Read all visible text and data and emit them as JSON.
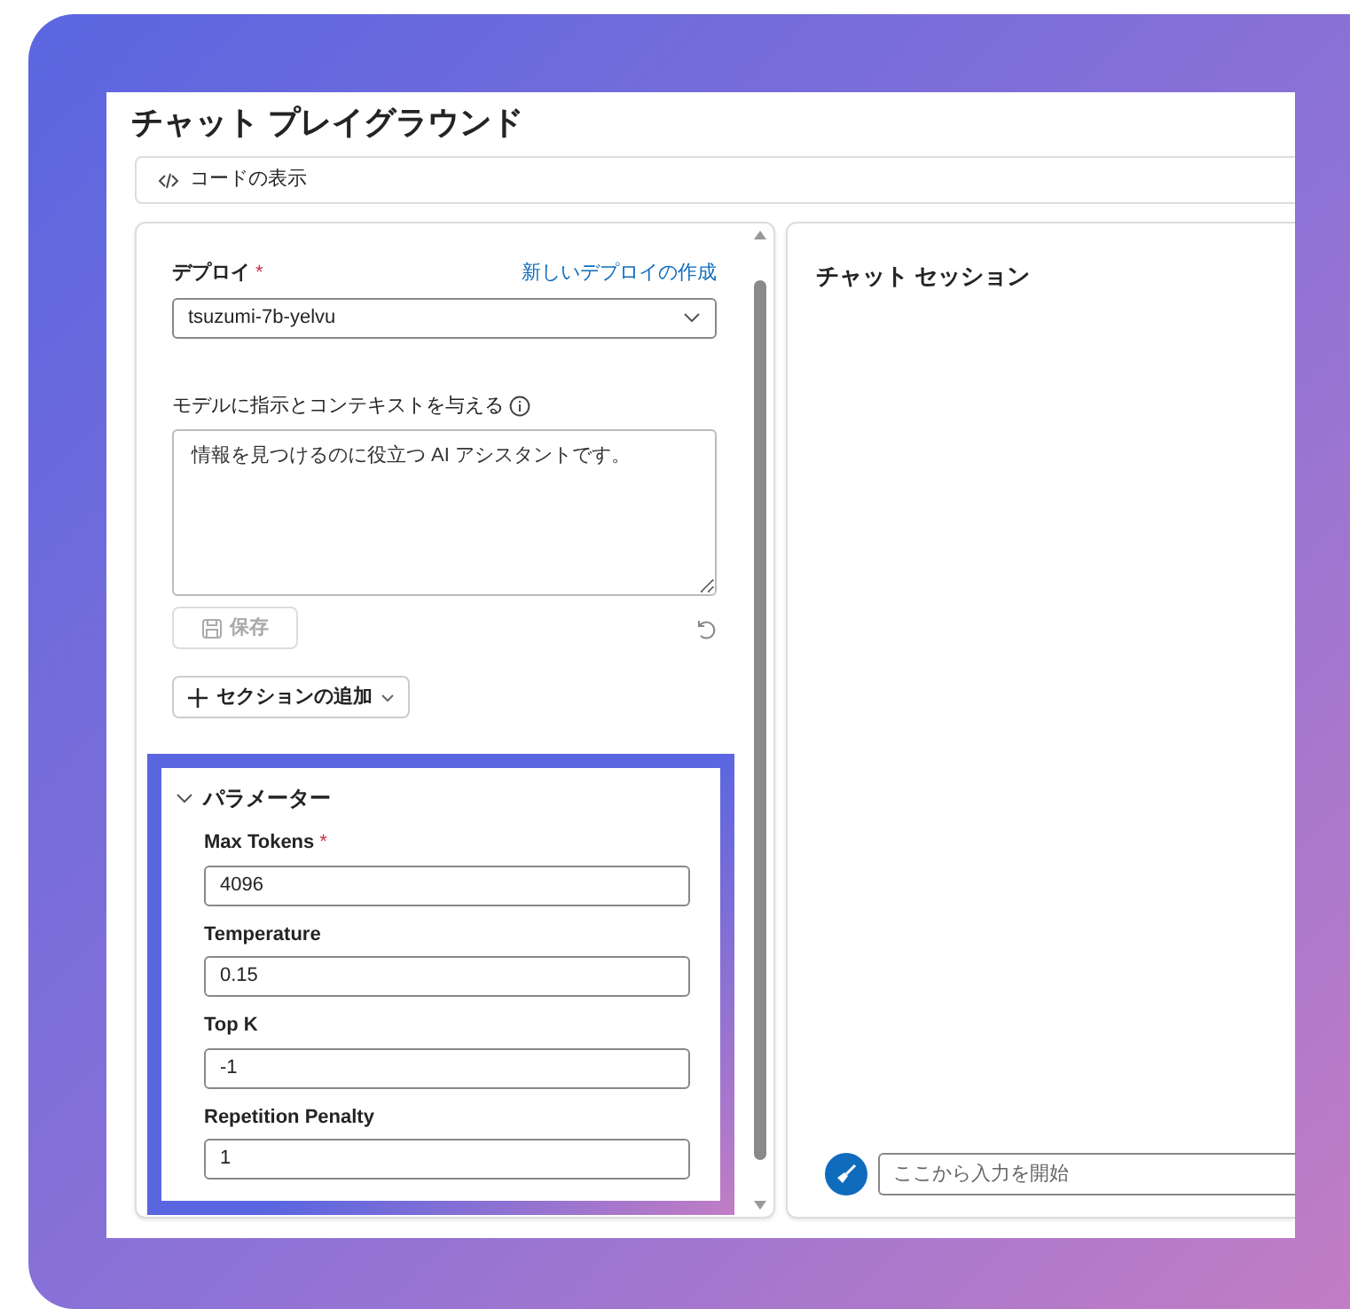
{
  "title": "チャット プレイグラウンド",
  "code_button": "コードの表示",
  "deploy": {
    "label": "デプロイ",
    "required_mark": "*",
    "create_link": "新しいデプロイの作成",
    "value": "tsuzumi-7b-yelvu"
  },
  "instructions": {
    "label": "モデルに指示とコンテキストを与える",
    "value": "情報を見つけるのに役立つ AI アシスタントです。"
  },
  "save_button": {
    "label": "保存",
    "disabled": true
  },
  "add_section_button": "セクションの追加",
  "parameters": {
    "title": "パラメーター",
    "expanded": true,
    "fields": [
      {
        "label": "Max Tokens",
        "required_mark": "*",
        "value": "4096"
      },
      {
        "label": "Temperature",
        "value": "0.15"
      },
      {
        "label": "Top K",
        "value": "-1"
      },
      {
        "label": "Repetition Penalty",
        "value": "1"
      }
    ]
  },
  "chat": {
    "title": "チャット セッション",
    "input": {
      "placeholder": "ここから入力を開始"
    }
  }
}
